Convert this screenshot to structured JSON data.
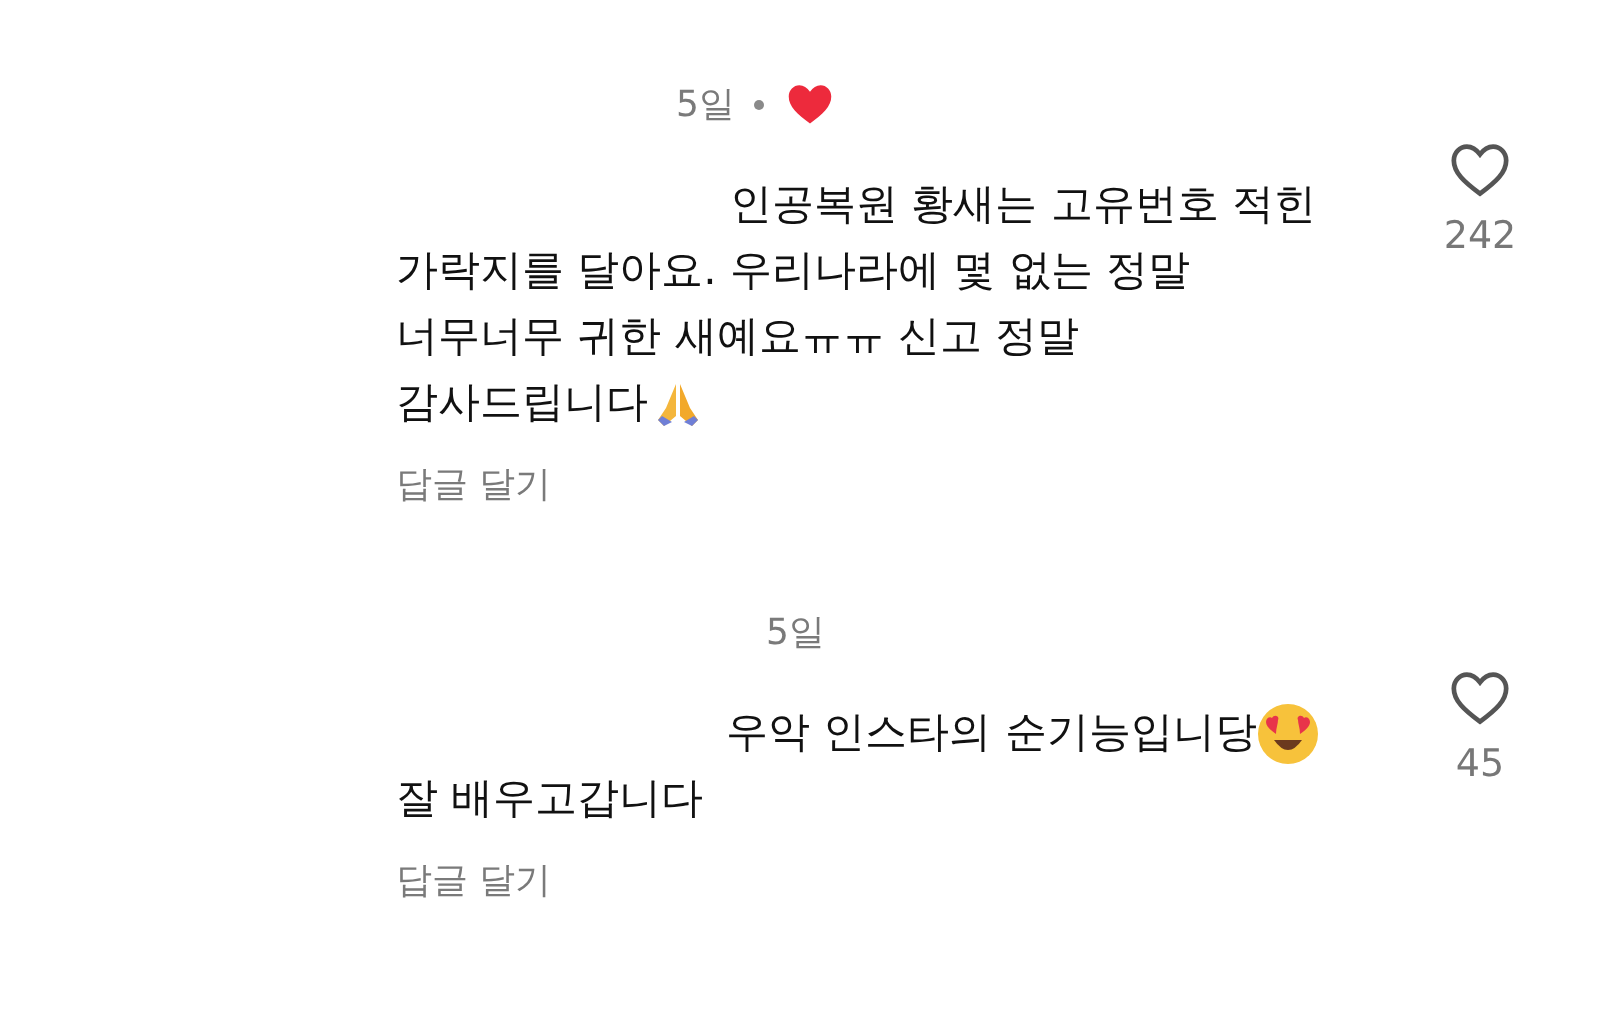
{
  "comments": [
    {
      "time": "5일",
      "liked_by_author": true,
      "lines": [
        {
          "text": "인공복원 황새는 고유번호 적힌"
        },
        {
          "text": "가락지를 달아요. 우리나라에 몇 없는 정말"
        },
        {
          "text": "너무너무 귀한 새예요ㅠㅠ 신고 정말"
        },
        {
          "text": "감사드립니다",
          "emoji": {
            "kind": "folded-hands"
          }
        }
      ],
      "reply": "답글 달기",
      "likes": "242"
    },
    {
      "time": "5일",
      "liked_by_author": false,
      "lines": [
        {
          "text": "우악 인스타의 순기능입니당",
          "emoji": {
            "kind": "heart-eyes"
          }
        },
        {
          "text": "잘 배우고갑니다"
        }
      ],
      "reply": "답글 달기",
      "likes": "45"
    }
  ]
}
